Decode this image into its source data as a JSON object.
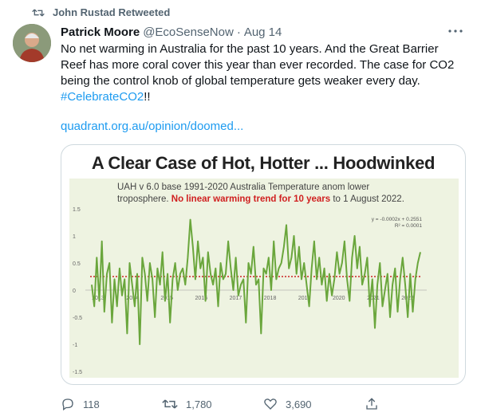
{
  "retweet": {
    "label": "John Rustad Retweeted",
    "icon": "retweet-icon"
  },
  "tweet": {
    "author_name": "Patrick Moore",
    "handle": "@EcoSenseNow",
    "separator": "·",
    "date": "Aug 14",
    "text_before_hashtag": "No net warming in Australia for the past 10 years. And the Great Barrier Reef has more coral cover this year than ever recorded. The case for CO2 being the control knob of global temperature gets weaker every day. ",
    "hashtag": "#CelebrateCO2",
    "text_after_hashtag": "!!",
    "link": "quadrant.org.au/opinion/doomed..."
  },
  "card": {
    "title": "A Clear Case of Hot, Hotter ... Hoodwinked",
    "subtitle_line1": "UAH v 6.0 base 1991-2020 Australia Temperature anom  lower",
    "subtitle_line2_start": "troposphere. ",
    "subtitle_line2_red": "No linear warming trend for 10 years",
    "subtitle_line2_end": " to 1 August 2022.",
    "regression_line1": "y = -0.0002x + 0.2551",
    "regression_line2": "R² = 0.0001"
  },
  "chart_data": {
    "type": "line",
    "title": "UAH v 6.0 base 1991-2020 Australia Temperature anom lower troposphere. No linear warming trend for 10 years to 1 August 2022.",
    "ylim": [
      -1.5,
      1.5
    ],
    "y_ticks": [
      "1.5",
      "1",
      "0.5",
      "0",
      "-0.5",
      "-1",
      "-1.5"
    ],
    "x_ticks": [
      "2013",
      "2014",
      "2015",
      "2016",
      "2017",
      "2018",
      "2019",
      "2020",
      "2021",
      "2022"
    ],
    "series": [
      {
        "color": "#6aa63c",
        "values": [
          0.1,
          -0.3,
          0.6,
          -0.2,
          0.9,
          -0.4,
          0.3,
          0.5,
          -0.6,
          0.2,
          -0.3,
          0.4,
          -0.1,
          0.2,
          -0.8,
          0.5,
          0.1,
          -0.3,
          0.3,
          -1.0,
          0.6,
          0.3,
          -0.2,
          0.5,
          0.2,
          -0.5,
          0.4,
          0.1,
          0.7,
          -0.2,
          0.3,
          -0.6,
          0.2,
          0.5,
          0.0,
          0.3,
          0.4,
          0.1,
          0.6,
          1.3,
          0.8,
          0.2,
          0.9,
          0.4,
          0.6,
          -0.2,
          0.7,
          0.3,
          0.1,
          0.4,
          -0.3,
          0.5,
          0.2,
          0.3,
          0.9,
          0.4,
          0.0,
          0.6,
          -0.1,
          0.1,
          0.2,
          -0.6,
          0.5,
          0.3,
          0.8,
          0.1,
          0.2,
          -0.8,
          0.4,
          0.3,
          0.6,
          0.0,
          0.9,
          0.2,
          0.4,
          0.5,
          0.8,
          1.2,
          0.4,
          0.6,
          1.0,
          0.3,
          0.8,
          0.2,
          0.5,
          0.1,
          -0.3,
          0.4,
          0.9,
          0.2,
          0.6,
          0.1,
          0.4,
          -0.2,
          0.3,
          -0.1,
          0.2,
          0.7,
          0.3,
          0.5,
          0.9,
          0.2,
          -0.2,
          0.6,
          1.0,
          0.4,
          0.8,
          0.1,
          0.3,
          0.6,
          -0.3,
          0.2,
          -0.7,
          0.1,
          0.5,
          -0.3,
          0.0,
          0.3,
          -0.5,
          0.1,
          0.4,
          -0.4,
          0.2,
          0.6,
          0.1,
          -0.5,
          0.3,
          -0.4,
          0.2,
          0.5,
          0.7
        ]
      }
    ],
    "trend_line": {
      "color": "#cc2222",
      "style": "dotted",
      "value": 0.25
    }
  },
  "actions": [
    {
      "name": "reply",
      "icon": "reply-icon",
      "count": "118"
    },
    {
      "name": "retweet",
      "icon": "retweet-icon",
      "count": "1,780"
    },
    {
      "name": "like",
      "icon": "heart-icon",
      "count": "3,690"
    },
    {
      "name": "share",
      "icon": "share-icon",
      "count": ""
    }
  ],
  "colors": {
    "accent": "#1d9bf0",
    "muted": "#536471",
    "border": "#cfd9de"
  }
}
